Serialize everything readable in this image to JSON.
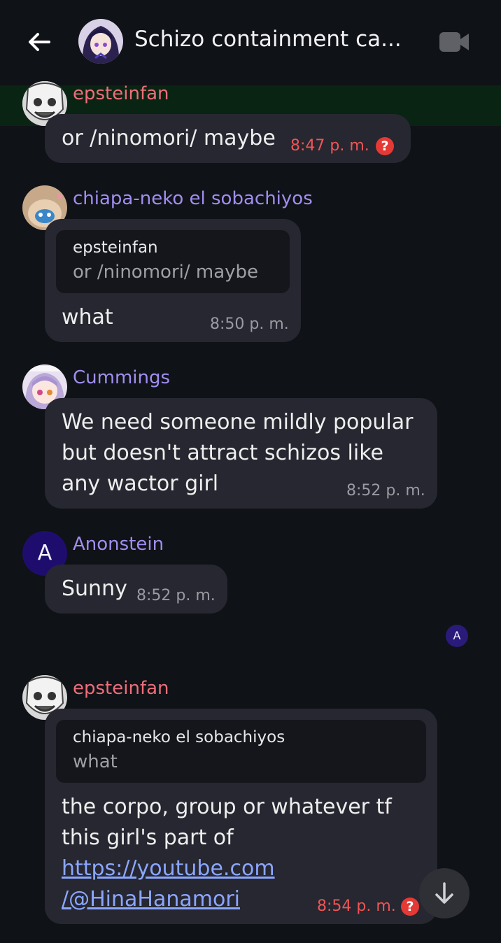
{
  "header": {
    "title": "Schizo containment ca...",
    "back_icon": "arrow-left-icon",
    "video_icon": "video-camera-icon"
  },
  "messages": [
    {
      "author": "epsteinfan",
      "author_color": "#ee6e7a",
      "text": "or /ninomori/ maybe",
      "time": "8:47 p. m.",
      "status": "error",
      "status_icon": "?"
    },
    {
      "author": "chiapa-neko el sobachiyos",
      "author_color": "#a08ef0",
      "reply": {
        "author": "epsteinfan",
        "text": "or /ninomori/ maybe"
      },
      "text": "what",
      "time": "8:50 p. m."
    },
    {
      "author": "Cummings",
      "author_color": "#a08ef0",
      "lines": [
        "We need someone mildly popular",
        "but doesn't attract schizos like",
        "any wactor girl"
      ],
      "time": "8:52 p. m."
    },
    {
      "author": "Anonstein",
      "author_color": "#a08ef0",
      "avatar_letter": "A",
      "text": "Sunny",
      "time": "8:52 p. m."
    },
    {
      "author": "epsteinfan",
      "author_color": "#ee6e7a",
      "reply": {
        "author": "chiapa-neko el sobachiyos",
        "text": "what"
      },
      "lines": [
        "the corpo, group or whatever tf",
        "this girl's part of"
      ],
      "link_lines": [
        "https://youtube.com",
        "/@HinaHanamori"
      ],
      "time": "8:54 p. m.",
      "status": "error",
      "status_icon": "?"
    }
  ],
  "read_receipt": "A",
  "scroll_button_icon": "arrow-down-icon"
}
